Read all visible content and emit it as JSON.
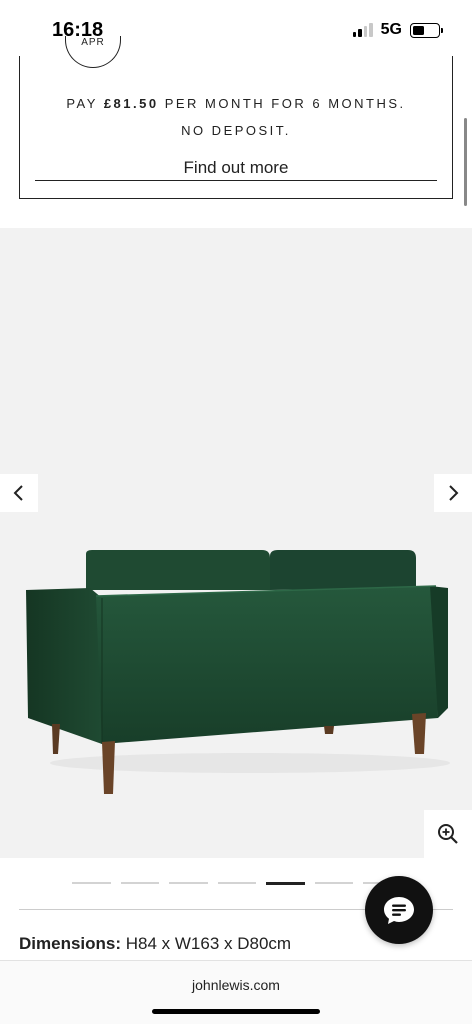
{
  "status_bar": {
    "time": "16:18",
    "network": "5G",
    "battery_level": 0.45,
    "signal_bars_active": 2
  },
  "finance": {
    "logo_text": "APR",
    "pay_prefix": "PAY ",
    "pay_amount": "£81.50",
    "pay_suffix": " PER MONTH FOR 6 MONTHS.",
    "deposit": "NO DEPOSIT.",
    "link": "Find out more"
  },
  "gallery": {
    "slide_count": 7,
    "active_slide": 5,
    "product_color": "#1f4a32",
    "icons": {
      "prev": "chevron-left-icon",
      "next": "chevron-right-icon",
      "zoom": "zoom-in-icon"
    }
  },
  "dimensions": {
    "label": "Dimensions:",
    "value": " H84 x W163 x D80cm"
  },
  "chat": {
    "icon": "chat-icon"
  },
  "browser": {
    "url": "johnlewis.com"
  }
}
